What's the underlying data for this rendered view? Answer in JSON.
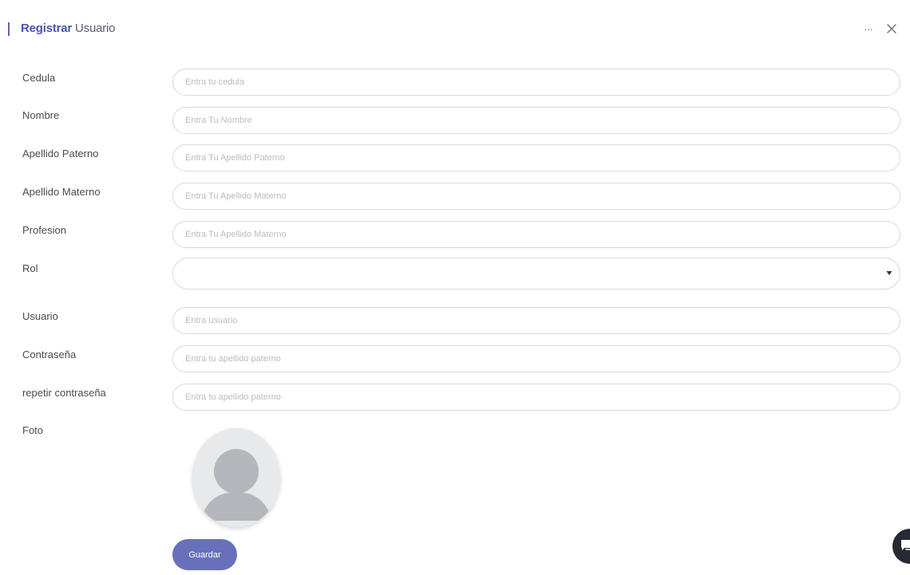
{
  "header": {
    "title_strong": "Registrar",
    "title_rest": " Usuario"
  },
  "form": {
    "cedula": {
      "label": "Cedula",
      "placeholder": "Entra tu cedula",
      "value": ""
    },
    "nombre": {
      "label": "Nombre",
      "placeholder": "Entra Tu Nombre",
      "value": ""
    },
    "apellido_paterno": {
      "label": "Apellido Paterno",
      "placeholder": "Entra Tu Apellido Paterno",
      "value": ""
    },
    "apellido_materno": {
      "label": "Apellido Materno",
      "placeholder": "Entra Tu Apellido Materno",
      "value": ""
    },
    "profesion": {
      "label": "Profesion",
      "placeholder": "Entra Tu Apellido Materno",
      "value": ""
    },
    "rol": {
      "label": "Rol",
      "selected": ""
    },
    "usuario": {
      "label": "Usuario",
      "placeholder": "Entra usuario",
      "value": ""
    },
    "contrasena": {
      "label": "Contraseña",
      "placeholder": "Entra tu apellido paterno",
      "value": ""
    },
    "repetir_contrasena": {
      "label": "repetir contraseña",
      "placeholder": "Entra tu apellido paterno",
      "value": ""
    },
    "foto": {
      "label": "Foto"
    }
  },
  "actions": {
    "save_label": "Guardar"
  },
  "icons": {
    "more": "more-horizontal-icon",
    "close": "close-icon",
    "dropdown": "chevron-down-icon",
    "avatar": "user-placeholder-icon",
    "chat": "chat-icon"
  },
  "colors": {
    "accent": "#5b64b0",
    "button": "#6870bb",
    "border": "#d6d9dd",
    "placeholder": "#b9bcc3"
  }
}
